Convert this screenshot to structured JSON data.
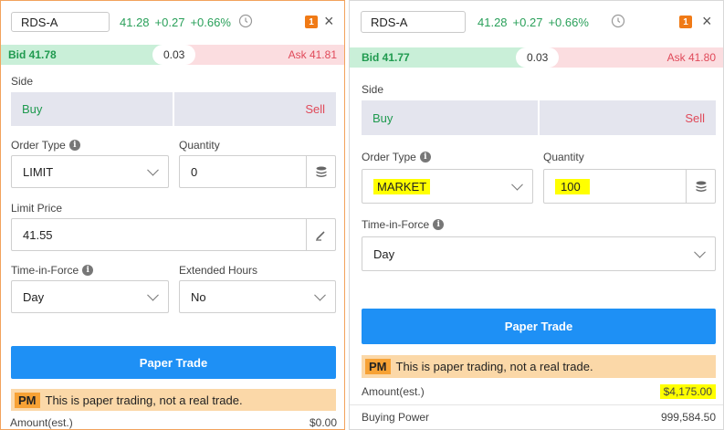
{
  "left": {
    "symbol": "RDS-A",
    "quote": {
      "last": "41.28",
      "change": "+0.27",
      "change_pct": "+0.66%"
    },
    "badge": "1",
    "close": "×",
    "bid": "Bid 41.78",
    "spread": "0.03",
    "ask": "Ask 41.81",
    "side_label": "Side",
    "buy_label": "Buy",
    "sell_label": "Sell",
    "order_type_label": "Order Type",
    "order_type_value": "LIMIT",
    "quantity_label": "Quantity",
    "quantity_value": "0",
    "limit_price_label": "Limit Price",
    "limit_price_value": "41.55",
    "tif_label": "Time-in-Force",
    "tif_value": "Day",
    "ext_hours_label": "Extended Hours",
    "ext_hours_value": "No",
    "trade_button": "Paper Trade",
    "pm_tag": "PM",
    "pm_notice": "This is paper trading, not a real trade.",
    "amount_label": "Amount(est.)",
    "amount_value": "$0.00"
  },
  "right": {
    "symbol": "RDS-A",
    "quote": {
      "last": "41.28",
      "change": "+0.27",
      "change_pct": "+0.66%"
    },
    "badge": "1",
    "close": "×",
    "bid": "Bid 41.77",
    "spread": "0.03",
    "ask": "Ask 41.80",
    "side_label": "Side",
    "buy_label": "Buy",
    "sell_label": "Sell",
    "order_type_label": "Order Type",
    "order_type_value": "MARKET",
    "quantity_label": "Quantity",
    "quantity_value": "100",
    "tif_label": "Time-in-Force",
    "tif_value": "Day",
    "trade_button": "Paper Trade",
    "pm_tag": "PM",
    "pm_notice": "This is paper trading, not a real trade.",
    "amount_label": "Amount(est.)",
    "amount_value": "$4,175.00",
    "buying_power_label": "Buying Power",
    "buying_power_value": "999,584.50"
  },
  "colors": {
    "positive": "#2aa05a",
    "negative": "#e04a5a",
    "accent": "#1e90f5",
    "highlight": "#ffff00",
    "focus_border": "#f2a25c"
  },
  "icons": [
    "clock-icon",
    "order-badge-icon",
    "close-icon",
    "info-icon",
    "chevron-down-icon",
    "stack-icon",
    "edit-pencil-icon"
  ]
}
